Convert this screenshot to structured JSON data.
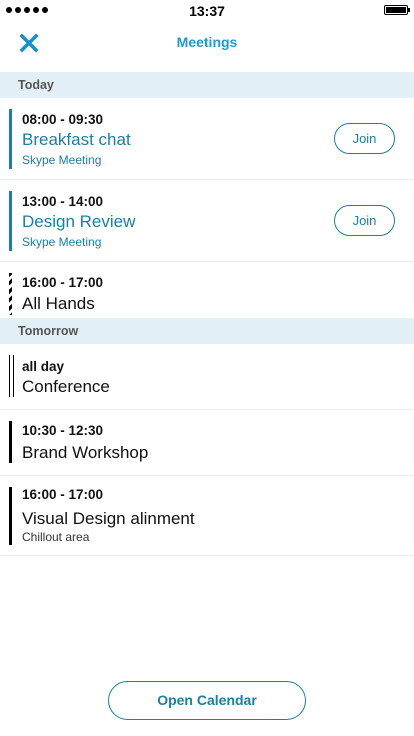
{
  "status_bar": {
    "time": "13:37"
  },
  "nav": {
    "title": "Meetings",
    "close_icon": "close-x-icon"
  },
  "sections": {
    "today": "Today",
    "tomorrow": "Tomorrow"
  },
  "meetings": [
    {
      "time": "08:00 - 09:30",
      "title": "Breakfast chat",
      "subtitle": "Skype Meeting",
      "action": "Join"
    },
    {
      "time": "13:00 - 14:00",
      "title": "Design Review",
      "subtitle": "Skype Meeting",
      "action": "Join"
    },
    {
      "time": "16:00 - 17:00",
      "title": "All Hands"
    },
    {
      "time": "all day",
      "title": "Conference"
    },
    {
      "time": "10:30 - 12:30",
      "title": "Brand Workshop"
    },
    {
      "time": "16:00 - 17:00",
      "title": "Visual Design alinment",
      "subtitle": "Chillout area"
    }
  ],
  "footer": {
    "open_calendar_label": "Open Calendar"
  },
  "colors": {
    "accent": "#1a7fa3",
    "title_accent": "#1d9ccc",
    "section_bg": "#e3eff6"
  }
}
